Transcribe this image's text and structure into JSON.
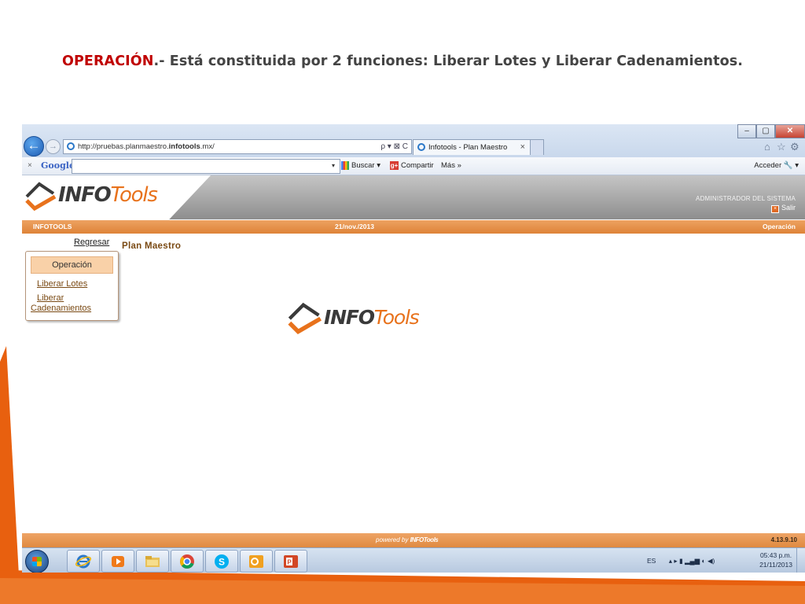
{
  "slide": {
    "title_accent": "OPERACIÓN",
    "title_rest": ".- Está constituida por 2 funciones: Liberar Lotes y Liberar Cadenamientos."
  },
  "browser": {
    "url_prefix": "http://pruebas.planmaestro.",
    "url_domain": "infotools",
    "url_suffix": ".mx/",
    "address_tools": "ρ ▾ ⊠ C",
    "tab_title": "Infotools - Plan Maestro",
    "tab_close": "×",
    "window_buttons": [
      "–",
      "▢",
      "✕"
    ],
    "right_icons": [
      "⌂",
      "☆",
      "⚙"
    ]
  },
  "google_toolbar": {
    "close": "×",
    "logo": "Google",
    "search_value": "",
    "dropdown": "▾",
    "buscar": "Buscar ▾",
    "compartir": "Compartir",
    "gplus": "g+",
    "mas": "Más »",
    "acceder": "Acceder 🔧 ▾"
  },
  "app": {
    "logo_word1": "INFO",
    "logo_word2": "Tools",
    "admin_label": "ADMINISTRADOR DEL SISTEMA",
    "logout": "Salir",
    "logout_icon": "×",
    "bar_left": "INFOTOOLS",
    "bar_date": "21/nov./2013",
    "bar_right": "Operación",
    "back_link": "Regresar",
    "page_title": "Plan Maestro",
    "menu": {
      "header": "Operación",
      "items": [
        "Liberar Lotes",
        "Liberar",
        "Cadenamientos"
      ]
    },
    "footer_powered": "powered by",
    "footer_brand": "INFOTools",
    "version": "4.13.9.10"
  },
  "taskbar": {
    "lang": "ES",
    "tray_icons": "▴  ▸  ▮  ▂▄▆  ◐  ◀)",
    "time": "05:43 p.m.",
    "date": "21/11/2013",
    "apps": [
      "internet-explorer",
      "media-player",
      "file-explorer",
      "chrome",
      "skype",
      "outlook",
      "powerpoint"
    ]
  },
  "colors": {
    "accent_orange": "#e8721c",
    "title_red": "#c00000",
    "bar_orange": "#de8338"
  }
}
